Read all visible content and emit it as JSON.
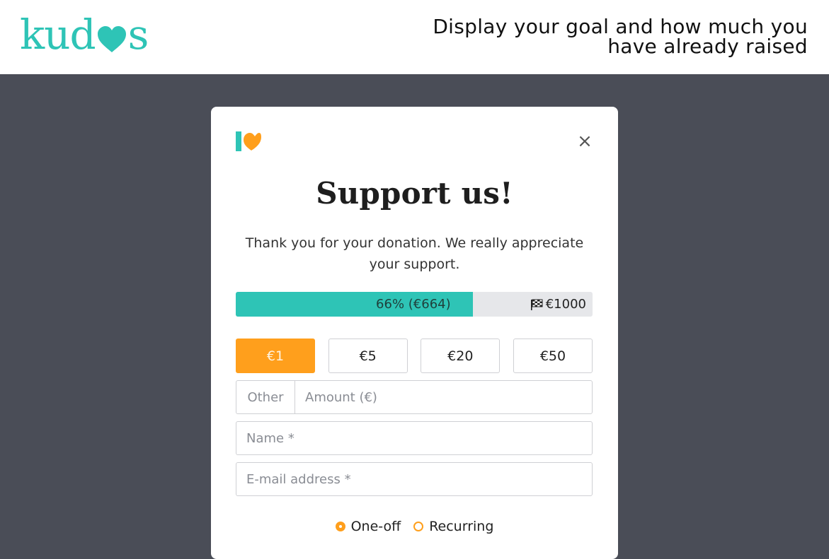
{
  "brand": {
    "logo_prefix": "kud",
    "logo_suffix": "s",
    "accent_color": "#2ec4b6",
    "secondary_color": "#ff9f1c"
  },
  "header": {
    "headline": "Display your goal and how much you have already raised"
  },
  "modal": {
    "logo_icon": "kudos-k-icon",
    "close_label": "×",
    "title": "Support us!",
    "subtitle": "Thank you for your donation. We really appreciate your support.",
    "progress": {
      "fraction": 0.664,
      "label": "66% (€664)",
      "goal_label": "€1000",
      "goal_icon": "checkered-flag-icon"
    },
    "amounts": [
      {
        "label": "€1",
        "selected": true
      },
      {
        "label": "€5",
        "selected": false
      },
      {
        "label": "€20",
        "selected": false
      },
      {
        "label": "€50",
        "selected": false
      }
    ],
    "other_label": "Other",
    "amount_placeholder": "Amount (€)",
    "name_placeholder": "Name *",
    "email_placeholder": "E-mail address *",
    "frequency": {
      "one_off_label": "One-off",
      "recurring_label": "Recurring",
      "selected": "One-off"
    }
  }
}
